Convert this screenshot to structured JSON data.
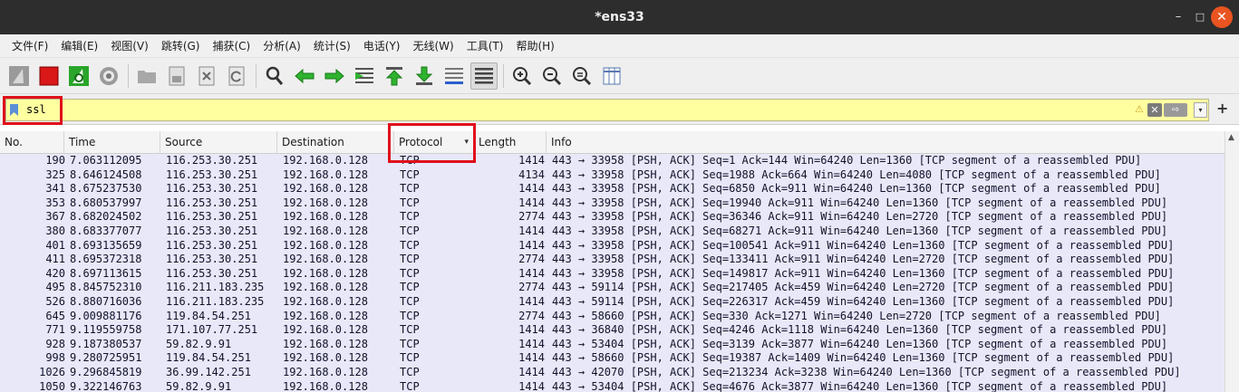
{
  "window": {
    "title": "*ens33",
    "minimize": "–",
    "maximize": "□",
    "close": "✕"
  },
  "menu": [
    {
      "label": "文件(F)"
    },
    {
      "label": "编辑(E)"
    },
    {
      "label": "视图(V)"
    },
    {
      "label": "跳转(G)"
    },
    {
      "label": "捕获(C)"
    },
    {
      "label": "分析(A)"
    },
    {
      "label": "统计(S)"
    },
    {
      "label": "电话(Y)"
    },
    {
      "label": "无线(W)"
    },
    {
      "label": "工具(T)"
    },
    {
      "label": "帮助(H)"
    }
  ],
  "toolbar": {
    "icons": [
      "shark-fin-start-icon",
      "stop-square-icon",
      "restart-fin-icon",
      "capture-options-gear-icon",
      "open-folder-icon",
      "save-file-icon",
      "close-file-icon",
      "reload-icon",
      "find-packet-icon",
      "go-back-icon",
      "go-forward-icon",
      "go-to-packet-icon",
      "go-first-packet-icon",
      "go-last-packet-icon",
      "auto-scroll-icon",
      "colorize-icon",
      "zoom-in-icon",
      "zoom-out-icon",
      "zoom-normal-icon",
      "resize-columns-icon"
    ]
  },
  "filter": {
    "value": "ssl",
    "warning_icon": "⚠",
    "clear_icon": "✕",
    "apply_icon": "⇨",
    "dropdown_icon": "▾",
    "add_icon": "+",
    "background": "#ffffa0"
  },
  "columns": {
    "no": "No.",
    "time": "Time",
    "source": "Source",
    "destination": "Destination",
    "protocol": "Protocol",
    "length": "Length",
    "info": "Info",
    "sort_indicator": "▾"
  },
  "packets": [
    {
      "no": "190",
      "time": "7.063112095",
      "source": "116.253.30.251",
      "destination": "192.168.0.128",
      "protocol": "TCP",
      "length": "1414",
      "info": "443 → 33958 [PSH, ACK] Seq=1 Ack=144 Win=64240 Len=1360 [TCP segment of a reassembled PDU]"
    },
    {
      "no": "325",
      "time": "8.646124508",
      "source": "116.253.30.251",
      "destination": "192.168.0.128",
      "protocol": "TCP",
      "length": "4134",
      "info": "443 → 33958 [PSH, ACK] Seq=1988 Ack=664 Win=64240 Len=4080 [TCP segment of a reassembled PDU]"
    },
    {
      "no": "341",
      "time": "8.675237530",
      "source": "116.253.30.251",
      "destination": "192.168.0.128",
      "protocol": "TCP",
      "length": "1414",
      "info": "443 → 33958 [PSH, ACK] Seq=6850 Ack=911 Win=64240 Len=1360 [TCP segment of a reassembled PDU]"
    },
    {
      "no": "353",
      "time": "8.680537997",
      "source": "116.253.30.251",
      "destination": "192.168.0.128",
      "protocol": "TCP",
      "length": "1414",
      "info": "443 → 33958 [PSH, ACK] Seq=19940 Ack=911 Win=64240 Len=1360 [TCP segment of a reassembled PDU]"
    },
    {
      "no": "367",
      "time": "8.682024502",
      "source": "116.253.30.251",
      "destination": "192.168.0.128",
      "protocol": "TCP",
      "length": "2774",
      "info": "443 → 33958 [PSH, ACK] Seq=36346 Ack=911 Win=64240 Len=2720 [TCP segment of a reassembled PDU]"
    },
    {
      "no": "380",
      "time": "8.683377077",
      "source": "116.253.30.251",
      "destination": "192.168.0.128",
      "protocol": "TCP",
      "length": "1414",
      "info": "443 → 33958 [PSH, ACK] Seq=68271 Ack=911 Win=64240 Len=1360 [TCP segment of a reassembled PDU]"
    },
    {
      "no": "401",
      "time": "8.693135659",
      "source": "116.253.30.251",
      "destination": "192.168.0.128",
      "protocol": "TCP",
      "length": "1414",
      "info": "443 → 33958 [PSH, ACK] Seq=100541 Ack=911 Win=64240 Len=1360 [TCP segment of a reassembled PDU]"
    },
    {
      "no": "411",
      "time": "8.695372318",
      "source": "116.253.30.251",
      "destination": "192.168.0.128",
      "protocol": "TCP",
      "length": "2774",
      "info": "443 → 33958 [PSH, ACK] Seq=133411 Ack=911 Win=64240 Len=2720 [TCP segment of a reassembled PDU]"
    },
    {
      "no": "420",
      "time": "8.697113615",
      "source": "116.253.30.251",
      "destination": "192.168.0.128",
      "protocol": "TCP",
      "length": "1414",
      "info": "443 → 33958 [PSH, ACK] Seq=149817 Ack=911 Win=64240 Len=1360 [TCP segment of a reassembled PDU]"
    },
    {
      "no": "495",
      "time": "8.845752310",
      "source": "116.211.183.235",
      "destination": "192.168.0.128",
      "protocol": "TCP",
      "length": "2774",
      "info": "443 → 59114 [PSH, ACK] Seq=217405 Ack=459 Win=64240 Len=2720 [TCP segment of a reassembled PDU]"
    },
    {
      "no": "526",
      "time": "8.880716036",
      "source": "116.211.183.235",
      "destination": "192.168.0.128",
      "protocol": "TCP",
      "length": "1414",
      "info": "443 → 59114 [PSH, ACK] Seq=226317 Ack=459 Win=64240 Len=1360 [TCP segment of a reassembled PDU]"
    },
    {
      "no": "645",
      "time": "9.009881176",
      "source": "119.84.54.251",
      "destination": "192.168.0.128",
      "protocol": "TCP",
      "length": "2774",
      "info": "443 → 58660 [PSH, ACK] Seq=330 Ack=1271 Win=64240 Len=2720 [TCP segment of a reassembled PDU]"
    },
    {
      "no": "771",
      "time": "9.119559758",
      "source": "171.107.77.251",
      "destination": "192.168.0.128",
      "protocol": "TCP",
      "length": "1414",
      "info": "443 → 36840 [PSH, ACK] Seq=4246 Ack=1118 Win=64240 Len=1360 [TCP segment of a reassembled PDU]"
    },
    {
      "no": "928",
      "time": "9.187380537",
      "source": "59.82.9.91",
      "destination": "192.168.0.128",
      "protocol": "TCP",
      "length": "1414",
      "info": "443 → 53404 [PSH, ACK] Seq=3139 Ack=3877 Win=64240 Len=1360 [TCP segment of a reassembled PDU]"
    },
    {
      "no": "998",
      "time": "9.280725951",
      "source": "119.84.54.251",
      "destination": "192.168.0.128",
      "protocol": "TCP",
      "length": "1414",
      "info": "443 → 58660 [PSH, ACK] Seq=19387 Ack=1409 Win=64240 Len=1360 [TCP segment of a reassembled PDU]"
    },
    {
      "no": "1026",
      "time": "9.296845819",
      "source": "36.99.142.251",
      "destination": "192.168.0.128",
      "protocol": "TCP",
      "length": "1414",
      "info": "443 → 42070 [PSH, ACK] Seq=213234 Ack=3238 Win=64240 Len=1360 [TCP segment of a reassembled PDU]"
    },
    {
      "no": "1050",
      "time": "9.322146763",
      "source": "59.82.9.91",
      "destination": "192.168.0.128",
      "protocol": "TCP",
      "length": "1414",
      "info": "443 → 53404 [PSH, ACK] Seq=4676 Ack=3877 Win=64240 Len=1360 [TCP segment of a reassembled PDU]"
    }
  ],
  "colors": {
    "row_background": "#e8e8f8",
    "row_text": "#12122b",
    "highlight_box": "#e0101a",
    "close_button": "#e95420"
  }
}
